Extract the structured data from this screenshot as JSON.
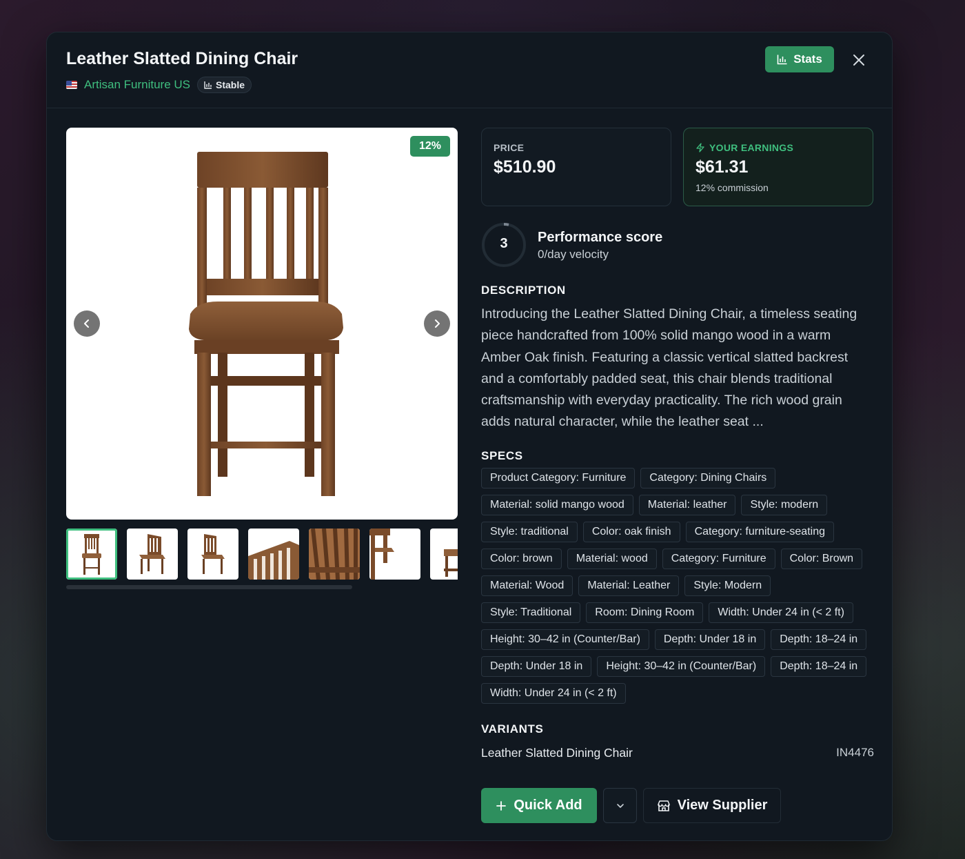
{
  "product": {
    "title": "Leather Slatted Dining Chair",
    "supplier": "Artisan Furniture US",
    "supplier_flag": "us-flag-icon",
    "stability_badge": "Stable"
  },
  "header": {
    "stats_label": "Stats",
    "close_icon": "close-icon"
  },
  "gallery": {
    "commission_badge": "12%",
    "thumbnail_count": 7,
    "active_thumbnail": 1
  },
  "price_card": {
    "label": "PRICE",
    "value": "$510.90"
  },
  "earnings_card": {
    "label": "YOUR EARNINGS",
    "value": "$61.31",
    "sub": "12% commission"
  },
  "performance": {
    "score": "3",
    "title": "Performance score",
    "velocity": "0/day velocity"
  },
  "description": {
    "heading": "DESCRIPTION",
    "text": "Introducing the Leather Slatted Dining Chair, a timeless seating piece handcrafted from 100% solid mango wood in a warm Amber Oak finish. Featuring a classic vertical slatted backrest and a comfortably padded seat, this chair blends traditional craftsmanship with everyday practicality. The rich wood grain adds natural character, while the leather seat ..."
  },
  "specs": {
    "heading": "SPECS",
    "items": [
      "Product Category: Furniture",
      "Category: Dining Chairs",
      "Material: solid mango wood",
      "Material: leather",
      "Style: modern",
      "Style: traditional",
      "Color: oak finish",
      "Category: furniture-seating",
      "Color: brown",
      "Material: wood",
      "Category: Furniture",
      "Color: Brown",
      "Material: Wood",
      "Material: Leather",
      "Style: Modern",
      "Style: Traditional",
      "Room: Dining Room",
      "Width: Under 24 in (< 2 ft)",
      "Height: 30–42 in (Counter/Bar)",
      "Depth: Under 18 in",
      "Depth: 18–24 in",
      "Depth: Under 18 in",
      "Height: 30–42 in (Counter/Bar)",
      "Depth: 18–24 in",
      "Width: Under 24 in (< 2 ft)"
    ]
  },
  "variants": {
    "heading": "VARIANTS",
    "items": [
      {
        "name": "Leather Slatted Dining Chair",
        "sku": "IN4476"
      }
    ]
  },
  "actions": {
    "quick_add": "Quick Add",
    "view_supplier": "View Supplier"
  },
  "colors": {
    "accent": "#2e8f5e",
    "accent_text": "#3fbf7f",
    "modal_bg": "#111820"
  }
}
